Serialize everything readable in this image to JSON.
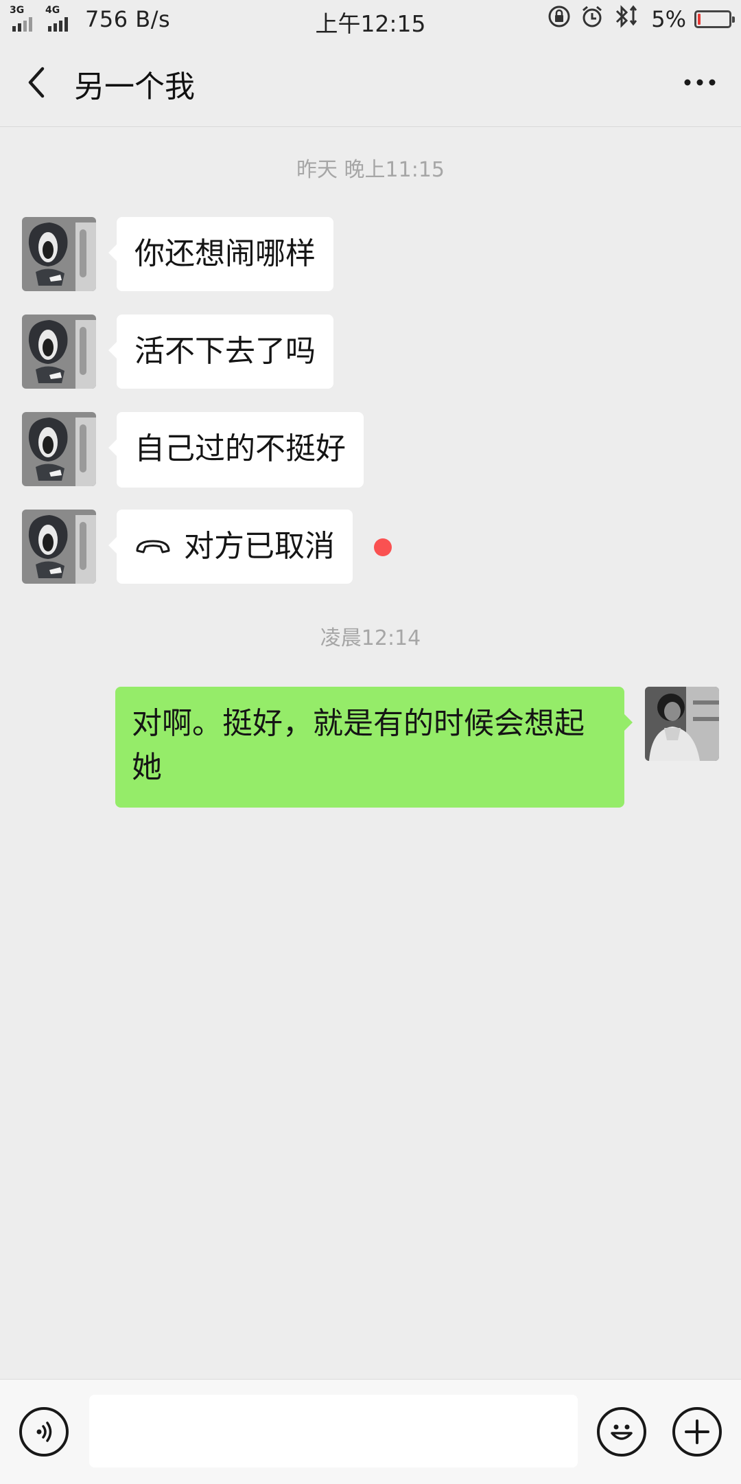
{
  "status_bar": {
    "sig1_gen": "3G",
    "sig2_gen": "4G",
    "speed": "756 B/s",
    "time": "上午12:15",
    "battery_pct": "5%"
  },
  "header": {
    "title": "另一个我"
  },
  "messages": {
    "ts1": "昨天 晚上11:15",
    "m1": "你还想闹哪样",
    "m2": "活不下去了吗",
    "m3": "自己过的不挺好",
    "m4": "对方已取消",
    "ts2": "凌晨12:14",
    "m5": "对啊。挺好，就是有的时候会想起她"
  },
  "input": {
    "value": ""
  },
  "colors": {
    "background": "#ededed",
    "incoming_bubble": "#ffffff",
    "outgoing_bubble": "#95ec69",
    "unread_dot": "#fa5151",
    "battery_low": "#e53935"
  }
}
